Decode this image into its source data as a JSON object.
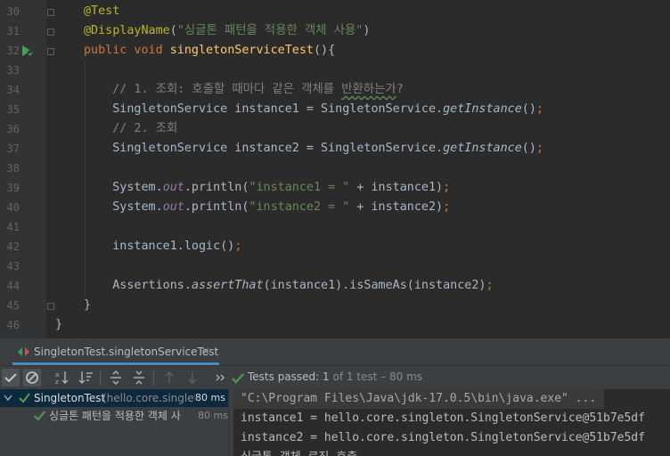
{
  "editor": {
    "line_numbers": [
      "30",
      "31",
      "32",
      "33",
      "34",
      "35",
      "36",
      "37",
      "38",
      "39",
      "40",
      "41",
      "42",
      "43",
      "44",
      "45",
      "46"
    ],
    "lines": [
      {
        "segments": [
          {
            "cls": "ann",
            "t": "@Test"
          }
        ]
      },
      {
        "segments": [
          {
            "cls": "ann",
            "t": "@DisplayName"
          },
          {
            "cls": "",
            "t": "("
          },
          {
            "cls": "str",
            "t": "\"싱글톤 패턴을 적용한 객체 사용\""
          },
          {
            "cls": "",
            "t": ")"
          }
        ]
      },
      {
        "segments": [
          {
            "cls": "kw",
            "t": "public void "
          },
          {
            "cls": "fn",
            "t": "singletonServiceTest"
          },
          {
            "cls": "",
            "t": "(){"
          }
        ]
      },
      {
        "segments": []
      },
      {
        "segments": [
          {
            "cls": "cm",
            "t": "    // 1. 조회: 호출할 때마다 같은 객체를 "
          },
          {
            "cls": "cm wavy",
            "t": "반환하는가"
          },
          {
            "cls": "cm",
            "t": "?"
          }
        ]
      },
      {
        "segments": [
          {
            "cls": "",
            "t": "    SingletonService instance1 = SingletonService."
          },
          {
            "cls": "it",
            "t": "getInstance"
          },
          {
            "cls": "",
            "t": "()"
          },
          {
            "cls": "kw",
            "t": ";"
          }
        ]
      },
      {
        "segments": [
          {
            "cls": "cm",
            "t": "    // 2. 조회"
          }
        ]
      },
      {
        "segments": [
          {
            "cls": "",
            "t": "    SingletonService instance2 = SingletonService."
          },
          {
            "cls": "it",
            "t": "getInstance"
          },
          {
            "cls": "",
            "t": "()"
          },
          {
            "cls": "kw",
            "t": ";"
          }
        ]
      },
      {
        "segments": []
      },
      {
        "segments": [
          {
            "cls": "",
            "t": "    System."
          },
          {
            "cls": "fld",
            "t": "out"
          },
          {
            "cls": "",
            "t": ".println("
          },
          {
            "cls": "str",
            "t": "\"instance1 = \""
          },
          {
            "cls": "",
            "t": " + instance1)"
          },
          {
            "cls": "kw",
            "t": ";"
          }
        ]
      },
      {
        "segments": [
          {
            "cls": "",
            "t": "    System."
          },
          {
            "cls": "fld",
            "t": "out"
          },
          {
            "cls": "",
            "t": ".println("
          },
          {
            "cls": "str",
            "t": "\"instance2 = \""
          },
          {
            "cls": "",
            "t": " + instance2)"
          },
          {
            "cls": "kw",
            "t": ";"
          }
        ]
      },
      {
        "segments": []
      },
      {
        "segments": [
          {
            "cls": "",
            "t": "    instance1.logic()"
          },
          {
            "cls": "kw",
            "t": ";"
          }
        ]
      },
      {
        "segments": []
      },
      {
        "segments": [
          {
            "cls": "",
            "t": "    Assertions."
          },
          {
            "cls": "it",
            "t": "assertThat"
          },
          {
            "cls": "",
            "t": "(instance1).isSameAs(instance2)"
          },
          {
            "cls": "kw",
            "t": ";"
          }
        ]
      },
      {
        "segments": [
          {
            "cls": "",
            "t": "}"
          }
        ]
      },
      {
        "segments": [
          {
            "cls": "",
            "t": "}"
          }
        ]
      }
    ]
  },
  "run_panel": {
    "tab_label": "SingletonTest.singletonServiceTest",
    "tab_close": "×",
    "status": {
      "prefix": "Tests passed: ",
      "passed": "1",
      "suffix": " of 1 test – 80 ms"
    },
    "tree": {
      "root_name": "SingletonTest",
      "root_pkg": "(hello.core.singletor",
      "root_time": "80 ms",
      "child_name": "싱글톤 패턴을 적용한 객체 사",
      "child_time": "80 ms"
    },
    "console_lines": [
      "\"C:\\Program Files\\Java\\jdk-17.0.5\\bin\\java.exe\" ...",
      "instance1 = hello.core.singleton.SingletonService@51b7e5df",
      "instance2 = hello.core.singleton.SingletonService@51b7e5df",
      "싱글톤 객체 로직 호출"
    ]
  },
  "colors": {
    "background": "#2b2b2b",
    "annotation": "#bbb529",
    "keyword": "#cc7832",
    "string": "#6a8759",
    "method": "#ffc66d",
    "comment": "#808080",
    "pass_green": "#499c54",
    "selection": "#0d293e"
  }
}
